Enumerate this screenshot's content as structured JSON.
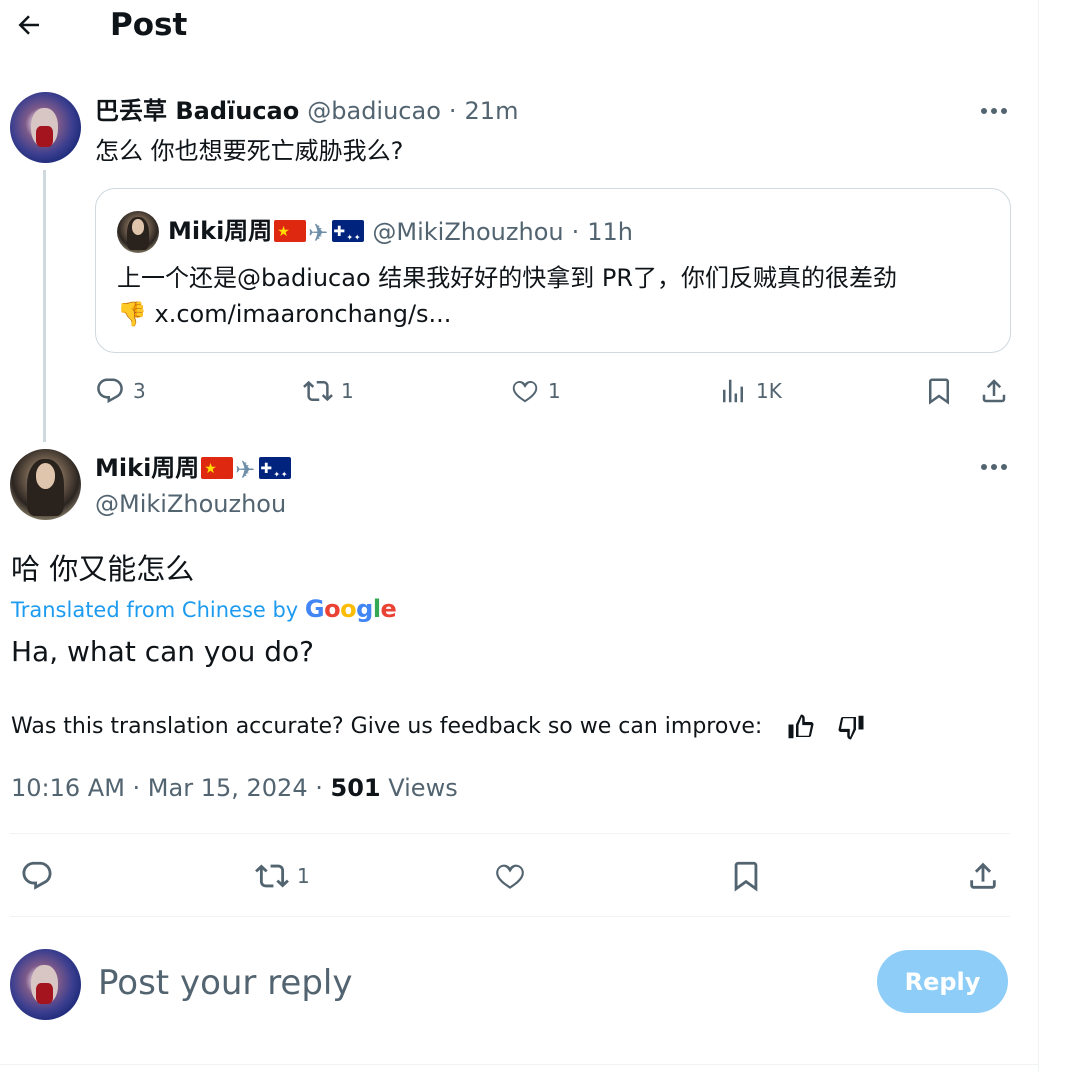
{
  "header": {
    "title": "Post"
  },
  "parent_post": {
    "author_name": "巴丢草 Badїucao",
    "handle": "@badiucao",
    "separator": "·",
    "time": "21m",
    "text": "怎么 你也想要死亡威胁我么?",
    "quote": {
      "author_name": "Miki周周",
      "handle": "@MikiZhouzhou",
      "separator": "·",
      "time": "11h",
      "line1": "上一个还是@badiucao 结果我好好的快拿到 PR了，你们反贼真的很差劲",
      "emoji": "👎",
      "line2": "x.com/imaaronchang/s..."
    },
    "stats": {
      "replies": "3",
      "reposts": "1",
      "likes": "1",
      "views": "1K"
    }
  },
  "main_post": {
    "author_name": "Miki周周",
    "handle": "@MikiZhouzhou",
    "text": "哈 你又能怎么",
    "translated_label": "Translated from Chinese by",
    "google": [
      "G",
      "o",
      "o",
      "g",
      "l",
      "e"
    ],
    "translation": "Ha, what can you do?",
    "feedback": "Was this translation accurate? Give us feedback so we can improve:",
    "timestamp": "10:16 AM · Mar 15, 2024 ·",
    "views_count": "501",
    "views_label": "Views",
    "stats": {
      "reposts": "1"
    }
  },
  "composer": {
    "placeholder": "Post your reply",
    "button": "Reply"
  },
  "colors": {
    "accent": "#1d9bf0",
    "muted": "#536471",
    "reply_btn": "#8ecdf7"
  },
  "icons": [
    "back-arrow-icon",
    "more-icon",
    "reply-icon",
    "repost-icon",
    "like-icon",
    "views-icon",
    "bookmark-icon",
    "share-icon",
    "thumbs-up-icon",
    "thumbs-down-icon",
    "plane-icon",
    "cn-flag-icon",
    "au-flag-icon"
  ]
}
